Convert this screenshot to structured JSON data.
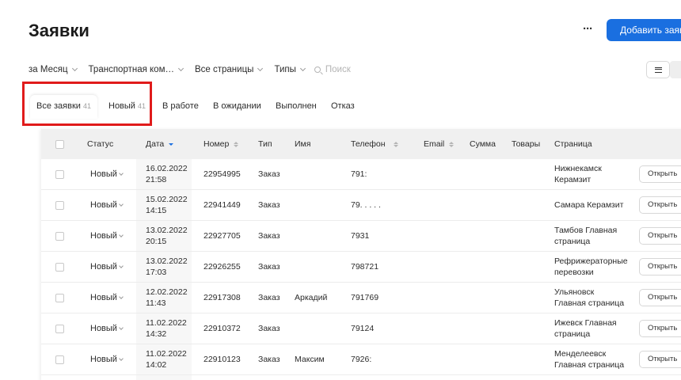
{
  "header": {
    "title": "Заявки",
    "more_label": "···",
    "add_button_label": "Добавить заявку"
  },
  "filters": {
    "period": "за Месяц",
    "transport": "Транспортная ком…",
    "pages": "Все страницы",
    "types": "Типы",
    "search_placeholder": "Поиск"
  },
  "tabs": [
    {
      "label": "Все заявки",
      "count": "41"
    },
    {
      "label": "Новый",
      "count": "41"
    },
    {
      "label": "В работе"
    },
    {
      "label": "В ожидании"
    },
    {
      "label": "Выполнен"
    },
    {
      "label": "Отказ"
    }
  ],
  "table": {
    "columns": {
      "status": "Статус",
      "date": "Дата",
      "number": "Номер",
      "type": "Тип",
      "name": "Имя",
      "phone": "Телефон",
      "email": "Email",
      "sum": "Сумма",
      "goods": "Товары",
      "page": "Страница"
    },
    "rows": [
      {
        "status": "Новый",
        "date": "16.02.2022",
        "time": "21:58",
        "number": "22954995",
        "type": "Заказ",
        "name": "",
        "phone": "791:",
        "page1": "Нижнекамск",
        "page2": "Керамзит",
        "action": "Открыть"
      },
      {
        "status": "Новый",
        "date": "15.02.2022",
        "time": "14:15",
        "number": "22941449",
        "type": "Заказ",
        "name": "",
        "phone": "79. . . . .",
        "page1": "Самара Керамзит",
        "page2": "",
        "action": "Открыть"
      },
      {
        "status": "Новый",
        "date": "13.02.2022",
        "time": "20:15",
        "number": "22927705",
        "type": "Заказ",
        "name": "",
        "phone": "7931",
        "page1": "Тамбов Главная",
        "page2": "страница",
        "action": "Открыть"
      },
      {
        "status": "Новый",
        "date": "13.02.2022",
        "time": "17:03",
        "number": "22926255",
        "type": "Заказ",
        "name": "",
        "phone": "798721",
        "page1": "Рефрижераторные",
        "page2": "перевозки",
        "action": "Открыть"
      },
      {
        "status": "Новый",
        "date": "12.02.2022",
        "time": "11:43",
        "number": "22917308",
        "type": "Заказ",
        "name": "Аркадий",
        "phone": "791769",
        "page1": "Ульяновск",
        "page2": "Главная страница",
        "action": "Открыть"
      },
      {
        "status": "Новый",
        "date": "11.02.2022",
        "time": "14:32",
        "number": "22910372",
        "type": "Заказ",
        "name": "",
        "phone": "79124",
        "page1": "Ижевск Главная",
        "page2": "страница",
        "action": "Открыть"
      },
      {
        "status": "Новый",
        "date": "11.02.2022",
        "time": "14:02",
        "number": "22910123",
        "type": "Заказ",
        "name": "Максим",
        "phone": "7926:",
        "page1": "Менделеевск",
        "page2": "Главная страница",
        "action": "Открыть"
      }
    ]
  },
  "colors": {
    "accent": "#1a6fe0",
    "highlight_frame": "#e01b1b"
  }
}
